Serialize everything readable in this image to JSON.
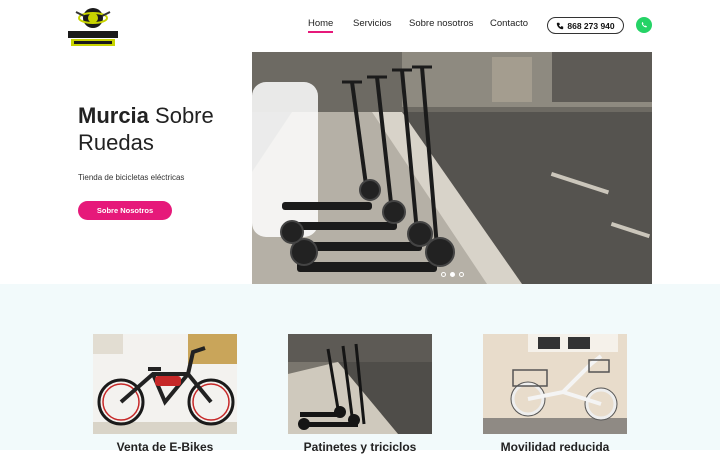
{
  "header": {
    "logo_alt": "Murcia Sobre Ruedas logo",
    "nav": [
      {
        "label": "Home",
        "active": true
      },
      {
        "label": "Servicios",
        "active": false
      },
      {
        "label": "Sobre nosotros",
        "active": false
      },
      {
        "label": "Contacto",
        "active": false
      }
    ],
    "phone": "868 273 940",
    "whatsapp_icon": "whatsapp-icon"
  },
  "hero": {
    "title_bold": "Murcia",
    "title_rest": " Sobre Ruedas",
    "subtitle": "Tienda de bicicletas eléctricas",
    "button": "Sobre Nosotros",
    "slides": 3,
    "active_slide": 2
  },
  "services": [
    {
      "title": "Venta de E-Bikes"
    },
    {
      "title": "Patinetes y triciclos"
    },
    {
      "title": "Movilidad reducida"
    }
  ],
  "colors": {
    "accent": "#e6197a",
    "section_bg": "#f2fafb",
    "whatsapp": "#25d366"
  }
}
